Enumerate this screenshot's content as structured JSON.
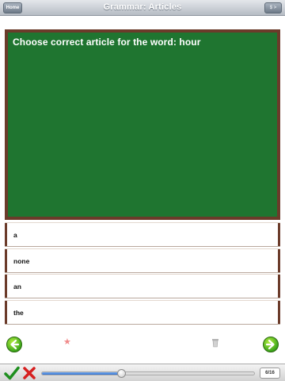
{
  "navbar": {
    "title": "Grammar: Articles",
    "home_label": "Home",
    "forward_label": "$ >"
  },
  "question": {
    "text": "Choose correct article for the word: hour"
  },
  "options": [
    {
      "label": "a"
    },
    {
      "label": "none"
    },
    {
      "label": "an"
    },
    {
      "label": "the"
    }
  ],
  "controls": {
    "prev_icon": "arrow-left-icon",
    "next_icon": "arrow-right-icon",
    "favorite_icon": "star-icon",
    "delete_icon": "trash-icon"
  },
  "toolbar": {
    "check_icon": "check-icon",
    "wrong_icon": "x-icon",
    "progress_current": 6,
    "progress_total": 16,
    "page_label": "6/16"
  },
  "colors": {
    "board_green": "#1f7530",
    "board_frame": "#6b3b2a",
    "arrow_green": "#3aa51a",
    "progress_blue": "#2f6fd1"
  }
}
